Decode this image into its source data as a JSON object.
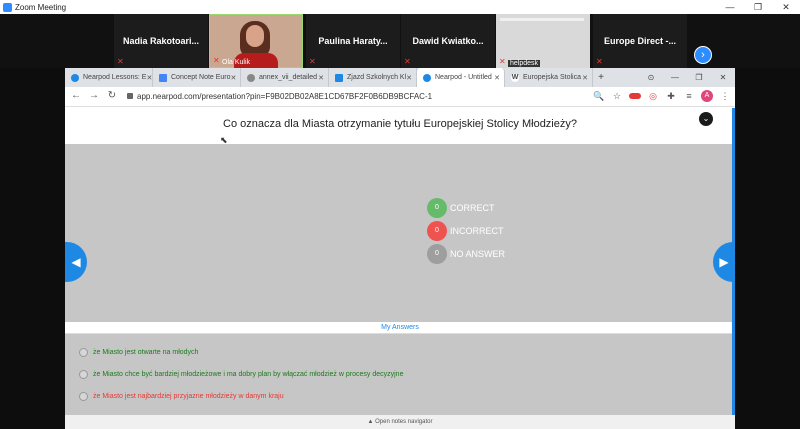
{
  "window": {
    "title": "Zoom Meeting",
    "controls": [
      "—",
      "❐",
      "✕"
    ]
  },
  "gallery": {
    "participants": [
      {
        "name": "Nadia  Rakotoari...",
        "type": "name"
      },
      {
        "name": "Ola Kulik",
        "type": "video"
      },
      {
        "name": "Paulina  Haraty...",
        "type": "name"
      },
      {
        "name": "Dawid  Kwiatko...",
        "type": "name"
      },
      {
        "name": "helpdesk",
        "type": "screen"
      },
      {
        "name": "Europe  Direct  -...",
        "type": "name"
      }
    ],
    "next_label": "›"
  },
  "browser": {
    "tabs": [
      {
        "label": "Nearpod Lessons: E",
        "color": "#1e88e5"
      },
      {
        "label": "Concept Note Euro",
        "color": "#4285f4"
      },
      {
        "label": "annex_vii_detailed",
        "color": "#888888"
      },
      {
        "label": "Zjazd Szkolnych Kl",
        "color": "#1e88e5"
      },
      {
        "label": "Nearpod - Untitled",
        "color": "#1e88e5"
      },
      {
        "label": "Europejska Stolica",
        "color": "#444444"
      }
    ],
    "active_tab": 4,
    "new_tab": "+",
    "tab_controls": [
      "⊙",
      "—",
      "❐",
      "✕"
    ],
    "nav": {
      "back": "←",
      "forward": "→",
      "reload": "↻"
    },
    "url": "app.nearpod.com/presentation?pin=F9B02DB02A8E1CD67BF2F0B6DB9BCFAC-1",
    "icons": [
      "🔍",
      "☆",
      "",
      "◎",
      "✚",
      "≡",
      "A",
      "⋮"
    ]
  },
  "question": {
    "text": "Co oznacza dla Miasta otrzymanie tytułu Europejskiej Stolicy Młodzieży?",
    "collapse": "⌄"
  },
  "results": [
    {
      "count": "0",
      "label": "CORRECT",
      "color": "#66bb6a"
    },
    {
      "count": "0",
      "label": "INCORRECT",
      "color": "#ef5350"
    },
    {
      "count": "0",
      "label": "NO ANSWER",
      "color": "#9e9e9e"
    }
  ],
  "nav_arrows": {
    "left": "◀",
    "right": "▶"
  },
  "answers_header": "My Answers",
  "answers": [
    {
      "text": "że Miasto jest otwarte na młodych",
      "status": "ok"
    },
    {
      "text": "że Miasto chce być bardziej młodzieżowe i ma dobry plan by włączać młodzież w procesy decyzyjne",
      "status": "ok"
    },
    {
      "text": "że Miasto jest najbardziej przyjazne młodzieży w danym kraju",
      "status": "bad"
    }
  ],
  "notes_label": "▲ Open notes navigator"
}
